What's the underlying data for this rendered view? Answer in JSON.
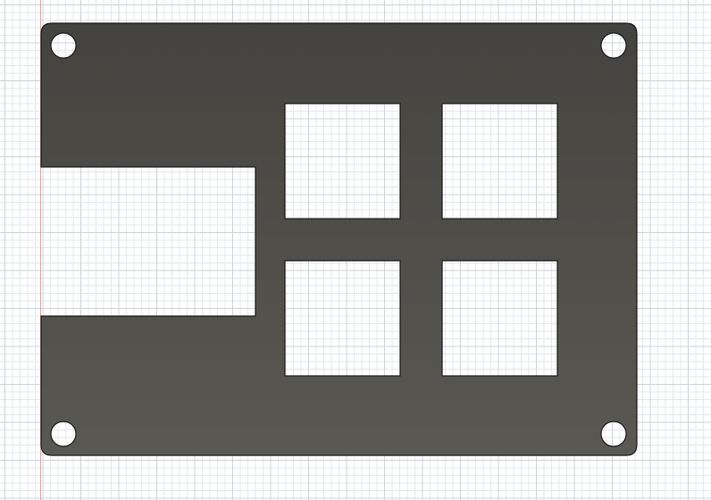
{
  "colors": {
    "canvas_background": "#ffffff",
    "grid_minor": "#e4e8ee",
    "grid_major": "#cdd4de",
    "axis_line": "#e8a0a0",
    "plate_fill_light": "#5a5853",
    "plate_fill_dark": "#44433f",
    "plate_edge": "#1c1c1c",
    "cutout_fill": "#ffffff"
  },
  "model": {
    "part": "plate",
    "features": {
      "mounting_holes": 4,
      "square_openings": 4,
      "edge_notch": 1
    }
  }
}
